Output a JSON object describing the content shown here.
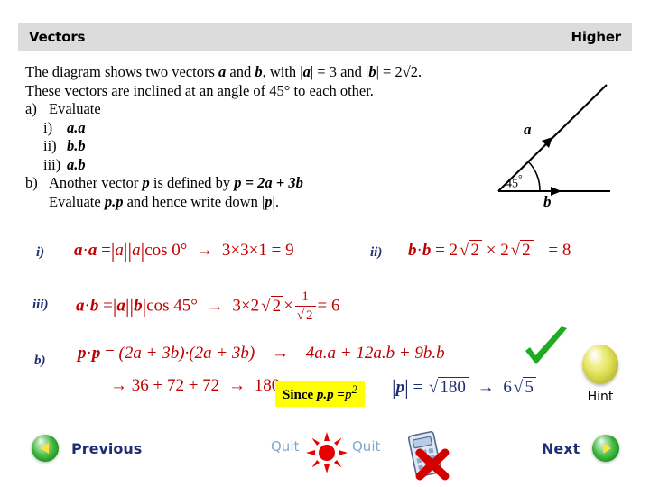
{
  "header": {
    "title": "Vectors",
    "level": "Higher"
  },
  "question": {
    "line1_part1": "The diagram shows two vectors",
    "line1_a": "a",
    "line1_and": "and",
    "line1_b": "b",
    "line1_part2": ", with |",
    "line1_a2": "a",
    "line1_part3": "| = 3 and |",
    "line1_b2": "b",
    "line1_part4": "| = 2√2.",
    "line2": "These vectors are inclined at an angle of 45° to each other.",
    "part_a_marker": "a)",
    "part_a_text": "Evaluate",
    "items": [
      {
        "marker": "i)",
        "text": "a.a"
      },
      {
        "marker": "ii)",
        "text": "b.b"
      },
      {
        "marker": "iii)",
        "text": "a.b"
      }
    ],
    "part_b_marker": "b)",
    "part_b_text_1": "Another vector",
    "part_b_p": "p",
    "part_b_text_2": "is defined by",
    "part_b_def": "p = 2a + 3b",
    "part_b_line2_1": "Evaluate",
    "part_b_pp": "p.p",
    "part_b_line2_2": "and hence write down |",
    "part_b_p2": "p",
    "part_b_line2_3": "|."
  },
  "diagram": {
    "label_a": "a",
    "label_b": "b",
    "angle": "45",
    "angle_unit": "°"
  },
  "answers": {
    "i": {
      "marker": "i)",
      "lhs_a1": "a",
      "dot": "·",
      "lhs_a2": "a",
      "equals": "=",
      "mod_a1": "a",
      "mod_a2": "a",
      "cos": "cos 0°",
      "arrow": "→",
      "result": "3×3×1 = 9"
    },
    "ii": {
      "marker": "ii)",
      "lhs_b1": "b",
      "dot": "·",
      "lhs_b2": "b",
      "equals": "=",
      "term1_coef": "2",
      "term1_rad": "2",
      "times": "×",
      "term2_coef": "2",
      "term2_rad": "2",
      "result": "= 8"
    },
    "iii": {
      "marker": "iii)",
      "lhs_a": "a",
      "dot": "·",
      "lhs_b": "b",
      "equals": "=",
      "mod_a": "a",
      "mod_b": "b",
      "cos": "cos 45°",
      "arrow": "→",
      "factor1": "3×",
      "factor2_coef": "2",
      "factor2_rad": "2",
      "times": "×",
      "frac_num": "1",
      "frac_den_rad": "2",
      "result": "= 6"
    },
    "b": {
      "marker": "b)",
      "lhs_p1": "p",
      "dot": "·",
      "lhs_p2": "p",
      "equals": "=",
      "expand": "(2a + 3b)·(2a + 3b)",
      "arrow": "→",
      "result": "4a.a + 12a.b + 9b.b",
      "line2_arrow": "→",
      "line2_sum": "36 + 72 + 72",
      "line2_arrow2": "→",
      "line2_total": "180"
    },
    "note": {
      "prefix": "Since",
      "pp": "p.p",
      "equals": "=",
      "psquared": "p",
      "exponent": "2"
    },
    "modulus": {
      "bar_open": "|",
      "p": "p",
      "bar_close": "|",
      "equals": "=",
      "radicand": "180",
      "arrow": "→",
      "result_coef": "6",
      "result_rad": "5"
    },
    "tick_icon": "green-check-icon"
  },
  "hint": {
    "label": "Hint",
    "icon": "yellow-orb-icon"
  },
  "toolbar": {
    "previous_label": "Previous",
    "next_label": "Next",
    "quit_label_left": "Quit",
    "quit_label_right": "Quit",
    "sun_icon": "red-sun-icon",
    "calculator_icon": "no-calculator-icon",
    "prev_orb_icon": "green-orb-left-icon",
    "next_orb_icon": "green-orb-right-icon"
  },
  "colors": {
    "header_bg": "#dcdcdc",
    "math_red": "#c00000",
    "math_blue": "#1f2d73",
    "highlight_yellow": "#ffff00",
    "tick_green": "#1faa1f",
    "quit_blue": "#7fa9cf"
  }
}
